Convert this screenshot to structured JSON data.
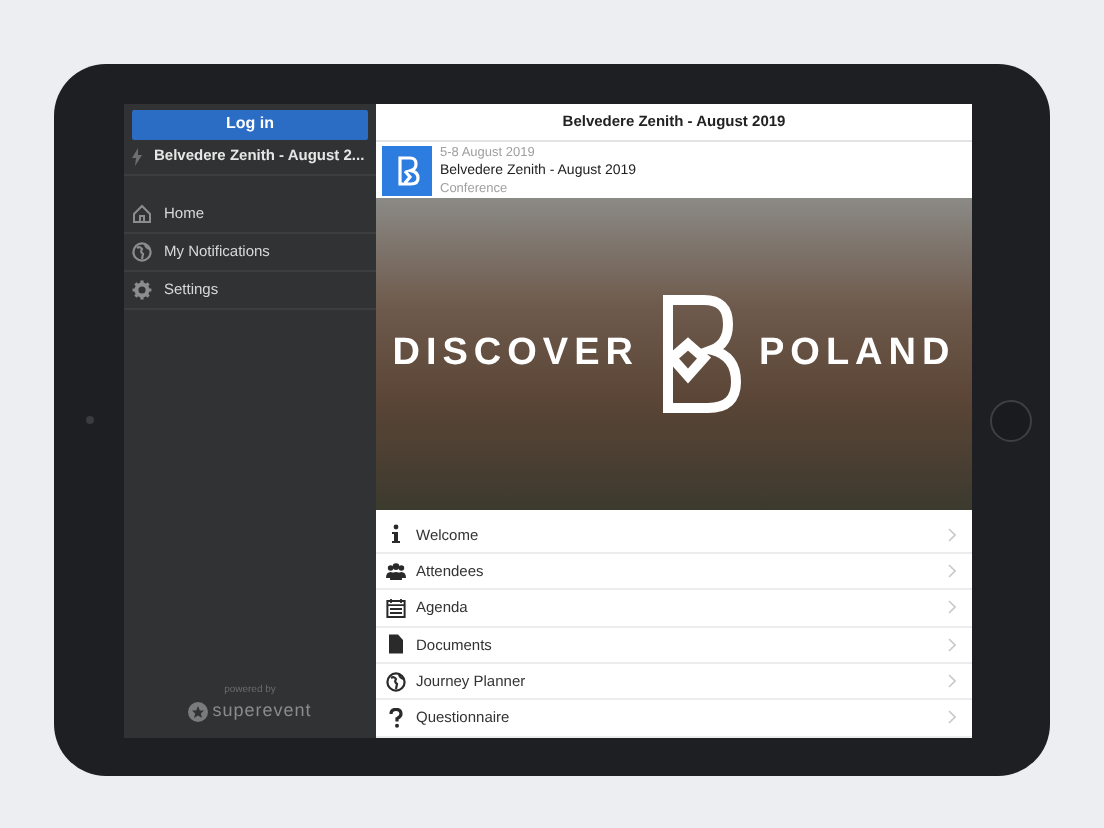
{
  "sidebar": {
    "login_button": "Log in",
    "event": "Belvedere Zenith - August 2...",
    "items": [
      {
        "label": "Home"
      },
      {
        "label": "My Notifications"
      },
      {
        "label": "Settings"
      }
    ],
    "footer": {
      "powered_by": "powered by",
      "brand": "superevent"
    }
  },
  "header": {
    "title": "Belvedere Zenith - August 2019"
  },
  "event_card": {
    "dates": "5-8 August 2019",
    "name": "Belvedere Zenith - August 2019",
    "type": "Conference"
  },
  "banner": {
    "left_word": "DISCOVER",
    "right_word": "POLAND"
  },
  "menu": [
    {
      "label": "Welcome"
    },
    {
      "label": "Attendees"
    },
    {
      "label": "Agenda"
    },
    {
      "label": "Documents"
    },
    {
      "label": "Journey Planner"
    },
    {
      "label": "Questionnaire"
    }
  ]
}
